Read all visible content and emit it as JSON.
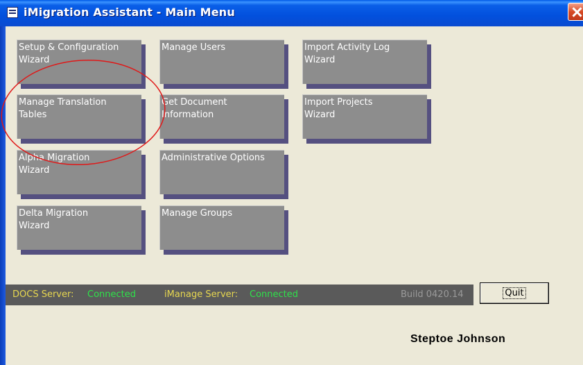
{
  "window": {
    "title": "iMigration Assistant - Main Menu"
  },
  "menu": {
    "col1": [
      {
        "label": "Setup & Configuration\nWizard"
      },
      {
        "label": "Manage Translation\nTables"
      },
      {
        "label": "Alpha Migration\nWizard"
      },
      {
        "label": " Delta Migration\nWizard"
      }
    ],
    "col2": [
      {
        "label": "Manage Users"
      },
      {
        "label": "Get Document\nInformation"
      },
      {
        "label": "Administrative Options"
      },
      {
        "label": "Manage Groups"
      }
    ],
    "col3": [
      {
        "label": "Import Activity Log\nWizard"
      },
      {
        "label": "Import Projects\nWizard"
      }
    ]
  },
  "status": {
    "docs_label": "DOCS Server:",
    "docs_value": "Connected",
    "imanage_label": "iManage Server:",
    "imanage_value": "Connected",
    "build": "Build 0420.14"
  },
  "quit_label": "Quit",
  "company": "Steptoe  Johnson",
  "colors": {
    "button_face": "#8D8D8D",
    "status_label": "#E8D850",
    "status_connected": "#2EE24A",
    "annotation_circle": "#E01818"
  }
}
